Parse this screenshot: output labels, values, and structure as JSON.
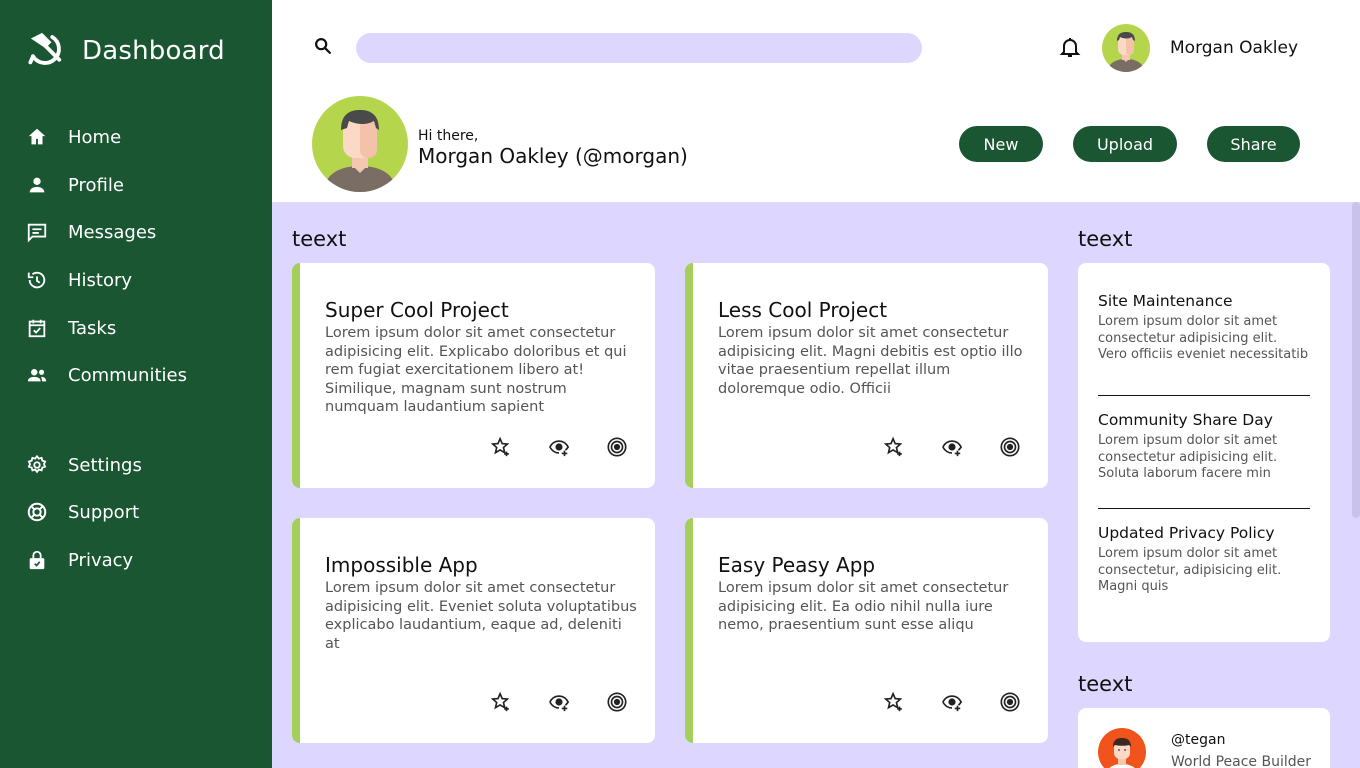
{
  "sidebar": {
    "brand": {
      "title": "Dashboard",
      "icon": "hammer-sickle-icon"
    },
    "nav_items": [
      {
        "label": "Home",
        "icon": "home-icon"
      },
      {
        "label": "Profile",
        "icon": "person-icon"
      },
      {
        "label": "Messages",
        "icon": "message-icon"
      },
      {
        "label": "History",
        "icon": "history-icon"
      },
      {
        "label": "Tasks",
        "icon": "tasks-icon"
      },
      {
        "label": "Communities",
        "icon": "communities-icon"
      }
    ],
    "settings_items": [
      {
        "label": "Settings",
        "icon": "gear-icon"
      },
      {
        "label": "Support",
        "icon": "lifebuoy-icon"
      },
      {
        "label": "Privacy",
        "icon": "lock-icon"
      }
    ]
  },
  "header": {
    "search": {
      "value": "",
      "placeholder": ""
    },
    "user_name": "Morgan Oakley",
    "greeting": "Hi there,",
    "greeting_name": "Morgan Oakley (@morgan)",
    "buttons": {
      "new": "New",
      "upload": "Upload",
      "share": "Share"
    }
  },
  "projects": {
    "title": "teext",
    "cards": [
      {
        "title": "Super Cool Project",
        "body": "Lorem ipsum dolor sit amet consectetur adipisicing elit. Explicabo doloribus et qui rem fugiat exercitationem libero at! Similique, magnam sunt nostrum numquam laudantium sapient"
      },
      {
        "title": "Less Cool Project",
        "body": "Lorem ipsum dolor sit amet consectetur adipisicing elit. Magni debitis est optio illo vitae praesentium repellat illum doloremque odio. Officii"
      },
      {
        "title": "Impossible App",
        "body": "Lorem ipsum dolor sit amet consectetur adipisicing elit. Eveniet soluta voluptatibus explicabo laudantium, eaque ad, deleniti at"
      },
      {
        "title": "Easy Peasy App",
        "body": "Lorem ipsum dolor sit amet consectetur adipisicing elit. Ea odio nihil nulla iure nemo, praesentium sunt esse aliqu"
      }
    ]
  },
  "announcements": {
    "title": "teext",
    "items": [
      {
        "title": "Site Maintenance",
        "body": "Lorem ipsum dolor sit amet consectetur adipisicing elit. Vero officiis eveniet necessitatib"
      },
      {
        "title": "Community Share Day",
        "body": "Lorem ipsum dolor sit amet consectetur adipisicing elit. Soluta laborum facere min"
      },
      {
        "title": "Updated Privacy Policy",
        "body": "Lorem ipsum dolor sit amet consectetur, adipisicing elit. Magni quis"
      }
    ]
  },
  "trending": {
    "title": "teext",
    "items": [
      {
        "handle": "@tegan",
        "subtitle": "World Peace Builder"
      }
    ]
  },
  "colors": {
    "sidebar": "#1a5632",
    "accent": "#a3cf5a",
    "background": "#ddd6fe",
    "avatar_bg": "#b5d64c",
    "trend_avatar_bg": "#f0531c"
  }
}
